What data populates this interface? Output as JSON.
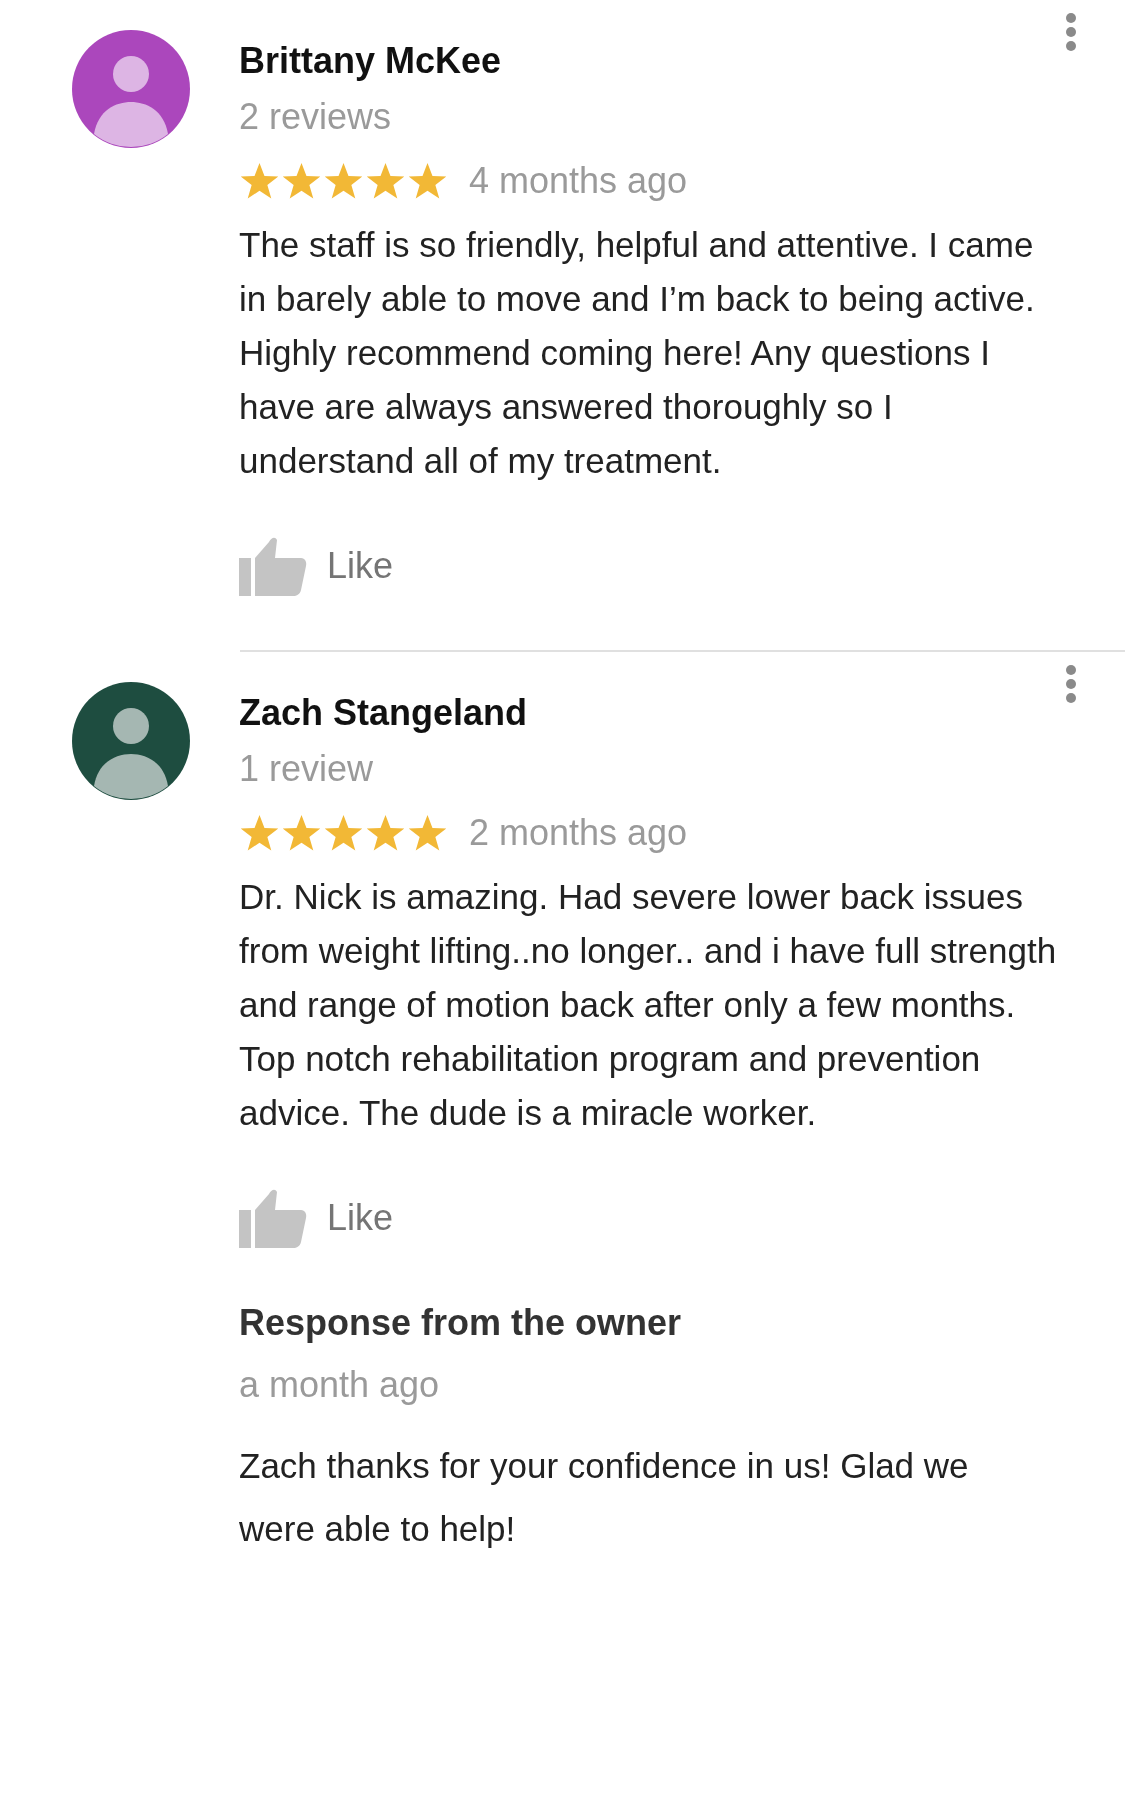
{
  "reviews": [
    {
      "author": "Brittany McKee",
      "review_count": "2 reviews",
      "stars": 5,
      "time": "4 months ago",
      "color": "#ab47bc",
      "text": "The staff is so friendly, helpful and attentive. I came in barely able to move and I’m back to being active. Highly recommend coming here! Any questions I have are always answered thoroughly so I understand all of my treatment.",
      "like_label": "Like"
    },
    {
      "author": "Zach Stangeland",
      "review_count": "1 review",
      "stars": 5,
      "time": "2 months ago",
      "color": "#1e4d40",
      "text": "Dr. Nick is amazing. Had severe lower back issues from weight lifting..no longer.. and i have full strength and range of motion back after only a few months. Top notch rehabilitation program and prevention advice. The dude is a miracle worker.",
      "like_label": "Like",
      "owner_response": {
        "title": "Response from the owner",
        "time": "a month ago",
        "text": "Zach thanks for your confidence in us! Glad we were able to help!"
      }
    }
  ]
}
